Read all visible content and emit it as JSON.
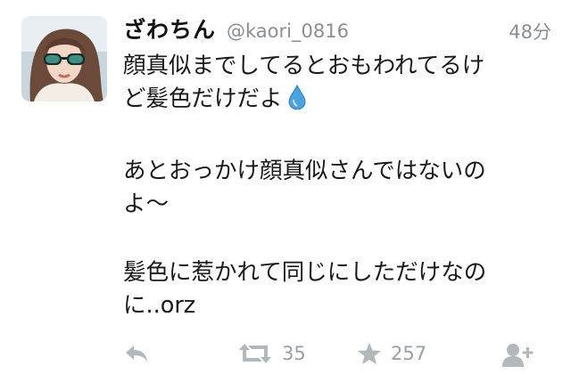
{
  "tweet": {
    "display_name": "ざわちん",
    "handle": "@kaori_0816",
    "timestamp": "48分",
    "lines": [
      "顔真似までしてるとおもわれてるけ",
      "ど髪色だけだよ",
      "あとおっかけ顔真似さんではないの",
      "よ～",
      "髪色に惹かれて同じにしただけなの",
      "に..orz"
    ],
    "emoji": "droplet-emoji",
    "retweet_count": "35",
    "favorite_count": "257"
  },
  "icons": {
    "reply": "reply-icon",
    "retweet": "retweet-icon",
    "favorite": "star-icon",
    "follow": "add-user-icon"
  },
  "colors": {
    "action_gray": "#a9aeb3",
    "meta_gray": "#8a8f94",
    "drop_blue": "#4aa3df"
  }
}
